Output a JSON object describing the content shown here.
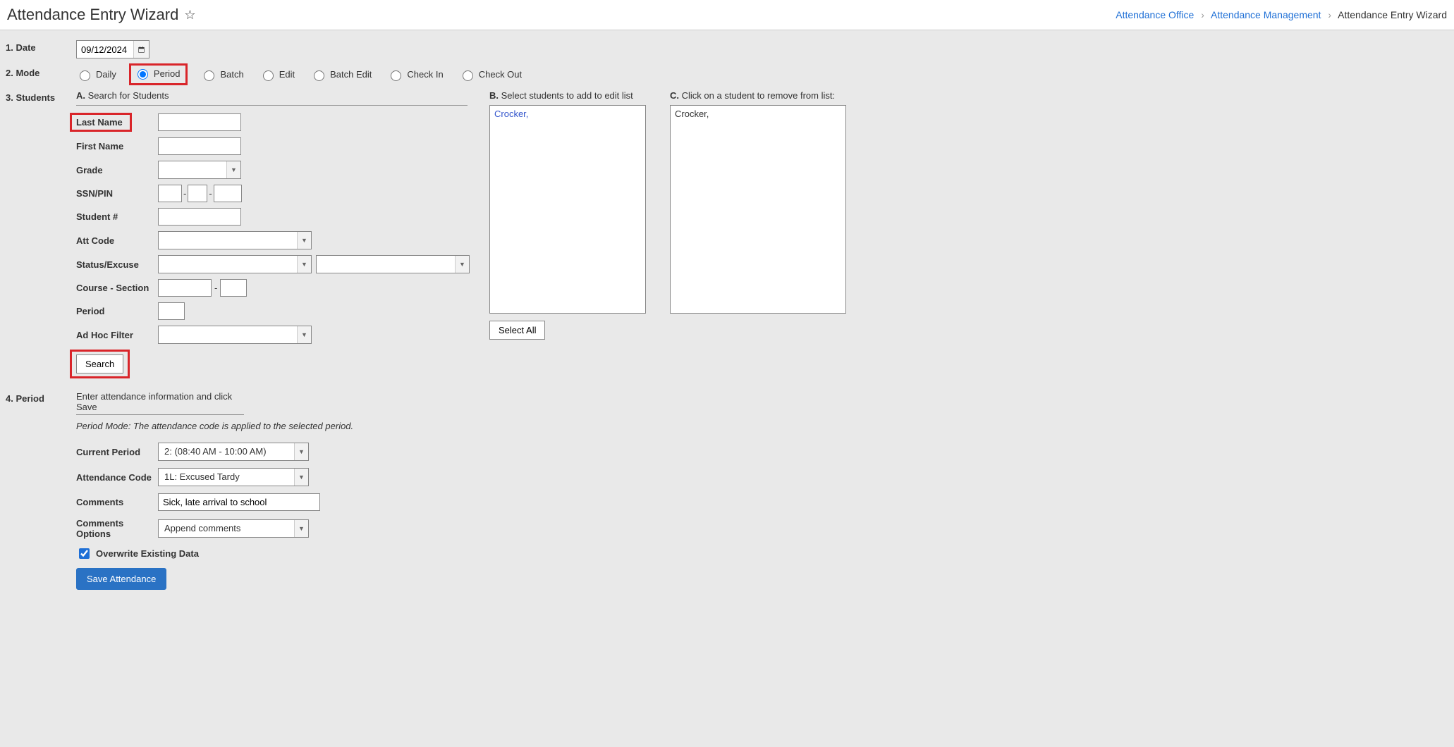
{
  "header": {
    "title": "Attendance Entry Wizard",
    "breadcrumb": {
      "a": "Attendance Office",
      "b": "Attendance Management",
      "c": "Attendance Entry Wizard"
    }
  },
  "steps": {
    "date_label": "1. Date",
    "mode_label": "2. Mode",
    "students_label": "3. Students",
    "period_label": "4. Period"
  },
  "date": {
    "value": "09/12/2024"
  },
  "modes": {
    "daily": "Daily",
    "period": "Period",
    "batch": "Batch",
    "edit": "Edit",
    "batch_edit": "Batch Edit",
    "check_in": "Check In",
    "check_out": "Check Out"
  },
  "students": {
    "a_heading_prefix": "A.",
    "a_heading_text": "Search for Students",
    "b_heading_prefix": "B.",
    "b_heading_text": "Select students to add to edit list",
    "c_heading_prefix": "C.",
    "c_heading_text": "Click on a student to remove from list:",
    "labels": {
      "last_name": "Last Name",
      "first_name": "First Name",
      "grade": "Grade",
      "ssn_pin": "SSN/PIN",
      "student_no": "Student #",
      "att_code": "Att Code",
      "status_excuse": "Status/Excuse",
      "course_section": "Course - Section",
      "period": "Period",
      "ad_hoc_filter": "Ad Hoc Filter"
    },
    "search_button": "Search",
    "select_all_button": "Select All",
    "list_b_item": "Crocker,",
    "list_c_item": "Crocker,"
  },
  "period": {
    "instruction": "Enter attendance information and click Save",
    "note": "Period Mode: The attendance code is applied to the selected period.",
    "labels": {
      "current_period": "Current Period",
      "attendance_code": "Attendance Code",
      "comments": "Comments",
      "comments_options": "Comments Options",
      "overwrite": "Overwrite Existing Data"
    },
    "values": {
      "current_period": "2: (08:40 AM - 10:00 AM)",
      "attendance_code": "1L: Excused Tardy",
      "comments": "Sick, late arrival to school",
      "comments_options": "Append comments"
    },
    "save_button": "Save Attendance"
  }
}
